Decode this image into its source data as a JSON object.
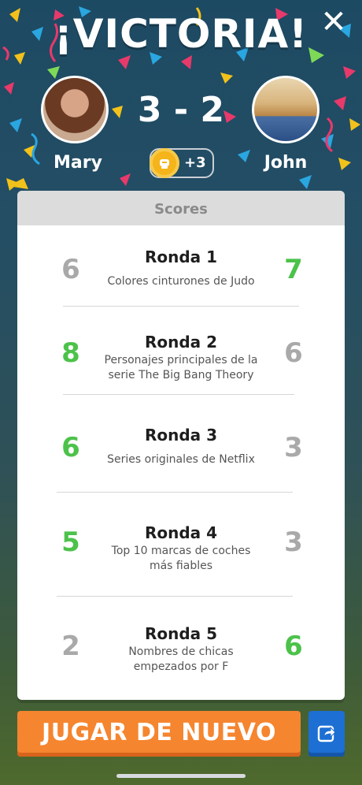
{
  "header": {
    "title": "¡VICTORIA!",
    "close_icon": "close-icon"
  },
  "players": {
    "left": {
      "name": "Mary"
    },
    "right": {
      "name": "John"
    },
    "score": "3 - 2",
    "reward": {
      "icon": "coin-icon",
      "label": "+3"
    }
  },
  "scores_card": {
    "title": "Scores",
    "rounds": [
      {
        "name": "Ronda 1",
        "desc": [
          "Colores cinturones de Judo"
        ],
        "left": "6",
        "right": "7",
        "winner": "right"
      },
      {
        "name": "Ronda 2",
        "desc": [
          "Personajes principales de la",
          "serie The Big Bang Theory"
        ],
        "left": "8",
        "right": "6",
        "winner": "left"
      },
      {
        "name": "Ronda 3",
        "desc": [
          "Series originales de Netflix"
        ],
        "left": "6",
        "right": "3",
        "winner": "left"
      },
      {
        "name": "Ronda 4",
        "desc": [
          "Top 10 marcas de coches",
          "más fiables"
        ],
        "left": "5",
        "right": "3",
        "winner": "left"
      },
      {
        "name": "Ronda 5",
        "desc": [
          "Nombres de chicas",
          "empezados por F"
        ],
        "left": "2",
        "right": "6",
        "winner": "right"
      }
    ]
  },
  "actions": {
    "play_again": "JUGAR DE NUEVO",
    "share_icon": "share-icon"
  },
  "colors": {
    "win": "#4cc24a",
    "lose": "#a9a9a9",
    "play_button": "#f5852f",
    "share_button": "#1d6fd3"
  }
}
